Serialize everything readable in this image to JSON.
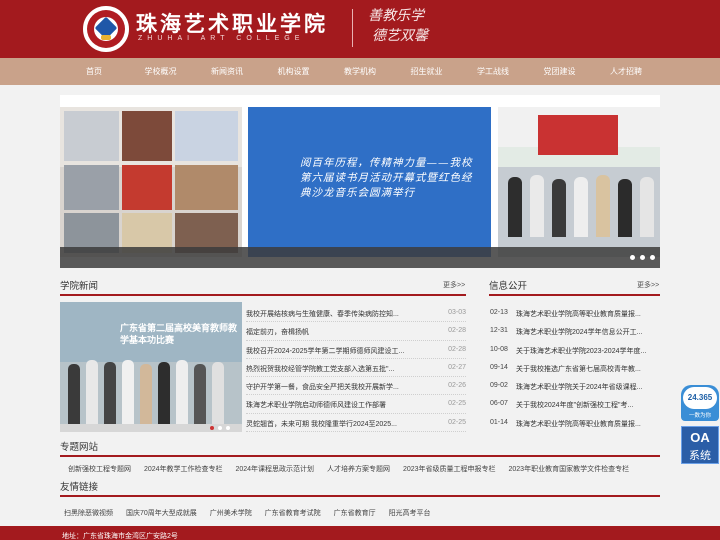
{
  "header": {
    "school_name_cn": "珠海艺术职业学院",
    "school_name_en": "ZHUHAI ART COLLEGE",
    "motto_line1": "善教乐学",
    "motto_line2": "德艺双馨",
    "logo_text": "ZHUHAI ART"
  },
  "nav": {
    "items": [
      "首页",
      "学校概况",
      "新闻资讯",
      "机构设置",
      "教学机构",
      "招生就业",
      "学工战线",
      "党团建设",
      "人才招聘"
    ]
  },
  "banner": {
    "headline": "阅百年历程，传精神力量——我校第六届读书月活动开幕式暨红色经典沙龙音乐会圆满举行",
    "slide_count": 3
  },
  "news": {
    "title": "学院新闻",
    "more": "更多>>",
    "image_caption": "广东省第二届高校美育教师教学基本功比赛",
    "items": [
      {
        "title": "我校开展结核病与生殖健康、春季传染病防控知...",
        "date": "03-03"
      },
      {
        "title": "福定前刃，奋楫扬帆",
        "date": "02-28"
      },
      {
        "title": "我校召开2024-2025学年第二学期师德师风建设工...",
        "date": "02-28"
      },
      {
        "title": "热烈祝贺我校经管学院教工党支部入选第五批\"...",
        "date": "02-27"
      },
      {
        "title": "守护开学第一餐，食品安全严把关我校开展新学...",
        "date": "02-26"
      },
      {
        "title": "珠海艺术职业学院启动师德师风建设工作部署",
        "date": "02-25"
      },
      {
        "title": "灵蛇翘首，未来可期 我校隆重举行2024至2025...",
        "date": "02-25"
      }
    ]
  },
  "info": {
    "title": "信息公开",
    "more": "更多>>",
    "items": [
      {
        "date": "02-13",
        "title": "珠海艺术职业学院高等职业教育质量报..."
      },
      {
        "date": "12-31",
        "title": "珠海艺术职业学院2024学年信息公开工..."
      },
      {
        "date": "10-08",
        "title": "关于珠海艺术职业学院2023-2024学年度..."
      },
      {
        "date": "09-14",
        "title": "关于我校推选广东省第七届高校青年教..."
      },
      {
        "date": "09-02",
        "title": "珠海艺术职业学院关于2024年省级课程..."
      },
      {
        "date": "06-07",
        "title": "关于我校2024年度\"创新强校工程\"考..."
      },
      {
        "date": "01-14",
        "title": "珠海艺术职业学院高等职业教育质量报..."
      }
    ]
  },
  "special": {
    "title": "专题网站",
    "items": [
      "创新强校工程专题网",
      "2024年教学工作检查专栏",
      "2024年课程思政示范计划",
      "人才培养方案专题网",
      "2023年省级质量工程申报专栏",
      "2023年职业教育国家教学文件检查专栏"
    ]
  },
  "friends": {
    "title": "友情链接",
    "items": [
      "扫黑除恶微视频",
      "国庆70周年大型成就展",
      "广州美术学院",
      "广东省教育考试院",
      "广东省教育厅",
      "阳光高考平台"
    ]
  },
  "footer": {
    "address": "地址：广东省珠海市金湾区广安路2号"
  },
  "floating": {
    "hotline": "24.365",
    "hotline_sub": "一数为你",
    "oa": "OA",
    "oa_sub": "系统"
  },
  "colors": {
    "brand_red": "#a31a1e",
    "nav_tan": "#c9a28a",
    "banner_blue": "#2f6fc6"
  }
}
